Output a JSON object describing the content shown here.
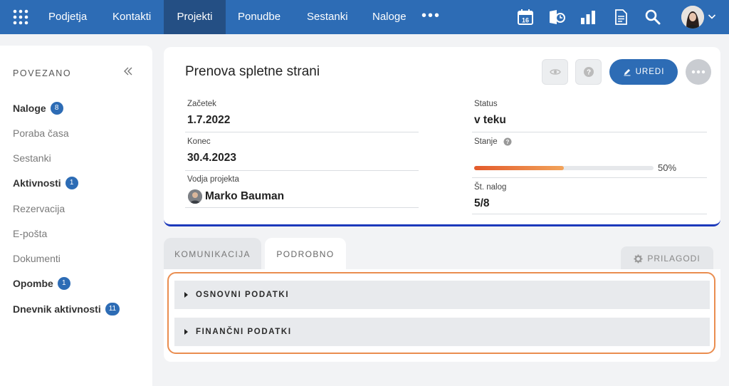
{
  "nav": {
    "items": [
      "Podjetja",
      "Kontakti",
      "Projekti",
      "Ponudbe",
      "Sestanki",
      "Naloge"
    ],
    "active": "Projekti",
    "more_label": "•••",
    "calendar_day": "16",
    "tools": [
      "calendar-icon",
      "time-tracking-icon",
      "reports-chart-icon",
      "document-icon",
      "search-icon"
    ]
  },
  "sidebar": {
    "title": "POVEZANO",
    "items": [
      {
        "label": "Naloge",
        "badge": "8",
        "bold": true
      },
      {
        "label": "Poraba časa",
        "bold": false
      },
      {
        "label": "Sestanki",
        "bold": false
      },
      {
        "label": "Aktivnosti",
        "badge": "1",
        "bold": true
      },
      {
        "label": "Rezervacija",
        "bold": false
      },
      {
        "label": "E-pošta",
        "bold": false
      },
      {
        "label": "Dokumenti",
        "bold": false
      },
      {
        "label": "Opombe",
        "badge": "1",
        "bold": true
      },
      {
        "label": "Dnevnik aktivnosti",
        "badge": "11",
        "bold": true
      }
    ]
  },
  "project": {
    "title": "Prenova spletne strani",
    "edit_label": "UREDI",
    "start_label": "Začetek",
    "start_value": "1.7.2022",
    "end_label": "Konec",
    "end_value": "30.4.2023",
    "manager_label": "Vodja projekta",
    "manager_value": "Marko Bauman",
    "status_label": "Status",
    "status_value": "v teku",
    "state_label": "Stanje",
    "progress_percent": 50,
    "progress_text": "50%",
    "tasks_label": "Št. nalog",
    "tasks_value": "5/8"
  },
  "tabs": {
    "communication": "KOMUNIKACIJA",
    "details": "PODROBNO",
    "customize": "PRILAGODI"
  },
  "sections": {
    "basic": "OSNOVNI PODATKI",
    "financial": "FINANČNI PODATKI"
  },
  "colors": {
    "nav_bg": "#2d6cb5",
    "nav_active_bg": "#244f84",
    "accent": "#2d6cb5",
    "progress_start": "#e35a2b",
    "progress_end": "#f2a35a",
    "highlight_outline": "#ea8d4f"
  }
}
